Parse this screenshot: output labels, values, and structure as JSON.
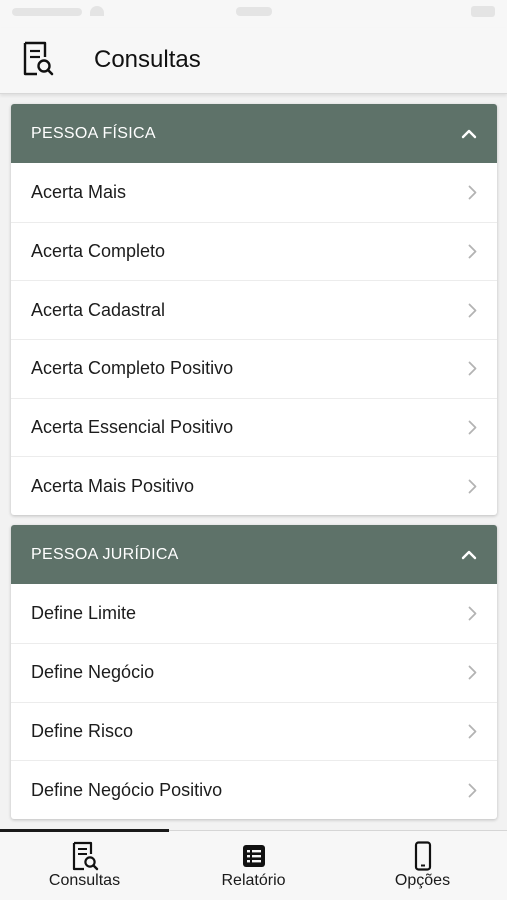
{
  "header": {
    "title": "Consultas",
    "icon": "document-search-icon"
  },
  "sections": [
    {
      "title": "PESSOA FÍSICA",
      "items": [
        "Acerta Mais",
        "Acerta Completo",
        "Acerta Cadastral",
        "Acerta Completo Positivo",
        "Acerta Essencial Positivo",
        "Acerta Mais Positivo"
      ]
    },
    {
      "title": "PESSOA JURÍDICA",
      "items": [
        "Define Limite",
        "Define Negócio",
        "Define Risco",
        "Define Negócio Positivo"
      ]
    }
  ],
  "tabs": [
    {
      "label": "Consultas",
      "icon": "document-search-icon",
      "active": true
    },
    {
      "label": "Relatório",
      "icon": "list-icon",
      "active": false
    },
    {
      "label": "Opções",
      "icon": "phone-icon",
      "active": false
    }
  ],
  "colors": {
    "section_header": "#5e7269",
    "background": "#f2f2f2"
  }
}
